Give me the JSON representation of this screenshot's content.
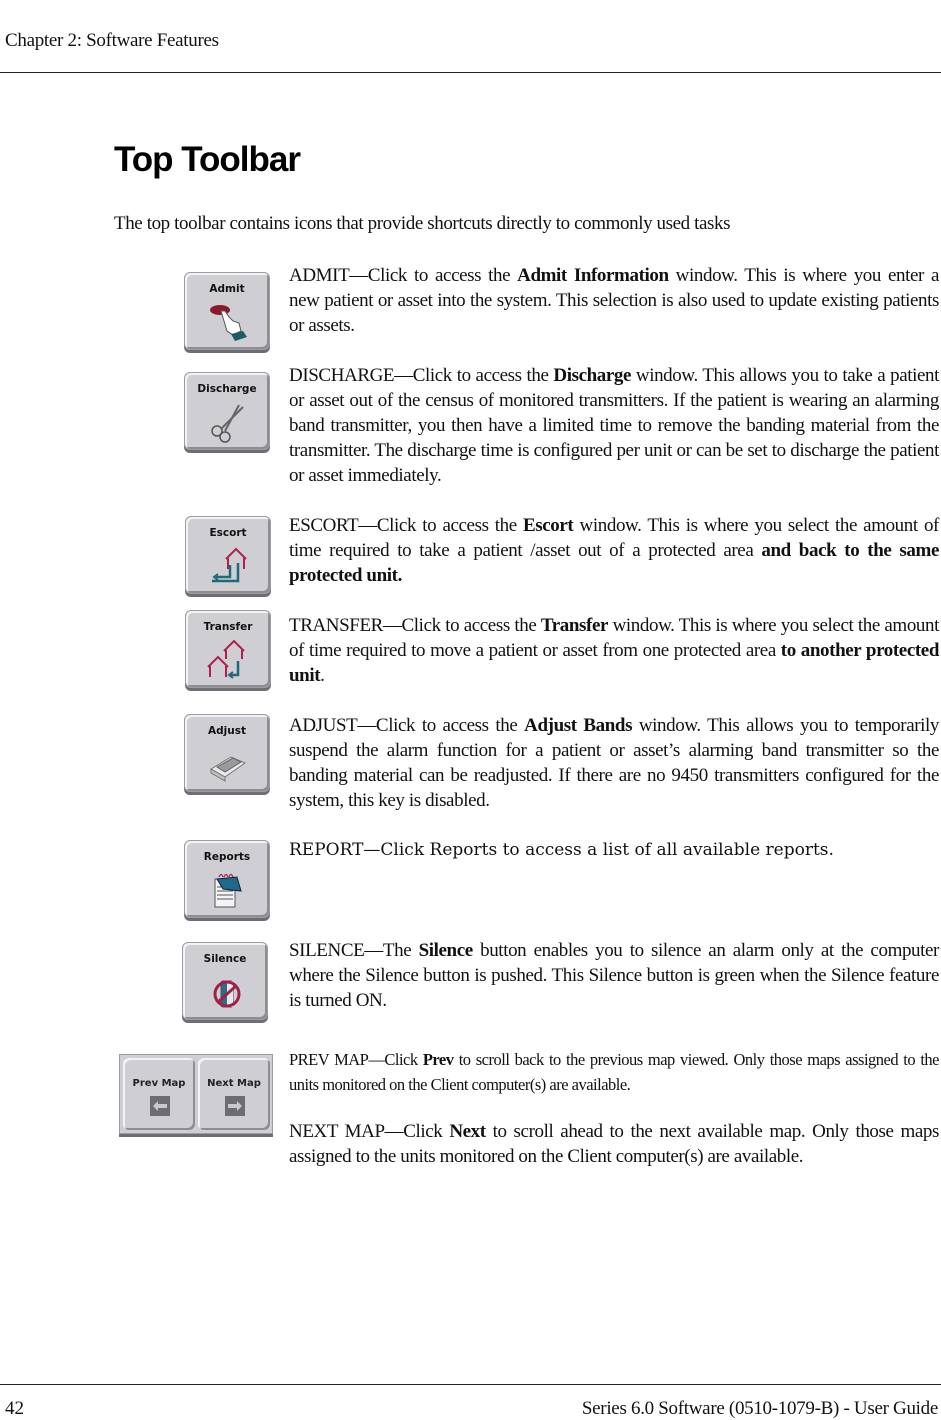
{
  "header": {
    "chapter": "Chapter 2: Software Features"
  },
  "title": "Top Toolbar",
  "intro": "The top toolbar contains icons that provide shortcuts directly to commonly used tasks",
  "buttons": [
    {
      "label": "Admit",
      "icon": "hand-pointer-icon"
    },
    {
      "label": "Discharge",
      "icon": "scissors-icon"
    },
    {
      "label": "Escort",
      "icon": "house-return-arrow-icon"
    },
    {
      "label": "Transfer",
      "icon": "house-to-house-arrow-icon"
    },
    {
      "label": "Adjust",
      "icon": "transmitter-band-icon"
    },
    {
      "label": "Reports",
      "icon": "notepad-icon"
    },
    {
      "label": "Silence",
      "icon": "speaker-muted-icon"
    },
    {
      "label": "Prev Map",
      "icon": "arrow-left-icon"
    },
    {
      "label": "Next Map",
      "icon": "arrow-right-icon"
    }
  ],
  "descriptions": {
    "admit": {
      "lead": "ADMIT—Click to access the ",
      "bold": "Admit Information",
      "rest": " window. This is where you enter a new patient or asset into the system. This selection is also used to update existing patients or assets."
    },
    "discharge": {
      "lead": "DISCHARGE—Click to access the ",
      "bold": "Discharge",
      "rest": " window. This allows you to take a patient or asset out of the census of monitored transmitters. If the patient is wearing an alarming band transmitter, you then have a limited time to remove the banding material from the transmitter. The discharge time is configured per unit or can be set to discharge the patient or asset immediately."
    },
    "escort": {
      "lead": "ESCORT—Click to access the ",
      "bold": "Escort",
      "mid": " window. This is where you select the amount of time required to take a patient /asset out of a protected area ",
      "bold2": "and back to the same protected unit."
    },
    "transfer": {
      "lead": "TRANSFER—Click to access the ",
      "bold": "Transfer",
      "mid": " window. This is where you select the amount of time required to move a patient or asset from one protected area ",
      "bold2": "to another protected unit",
      "tail": "."
    },
    "adjust": {
      "lead": "ADJUST—Click to access the ",
      "bold": "Adjust Bands",
      "rest": " window. This allows you to temporarily suspend the alarm function for a patient or asset’s alarming band transmitter so the banding material can be readjusted. If there are no 9450 transmitters configured for the system, this key is disabled."
    },
    "report": {
      "text": "REPORT—Click Reports to access a list of all available reports."
    },
    "silence": {
      "lead": "SILENCE—The ",
      "bold": "Silence",
      "rest": " button enables you to silence an alarm only at the computer where the Silence button is pushed. This Silence button is green when the Silence feature is turned ON."
    },
    "prev_map": {
      "lead": "PREV MAP—Click ",
      "bold": "Prev",
      "rest": " to scroll back to the previous map viewed. Only those maps assigned to the units monitored on the Client computer(s) are available."
    },
    "next_map": {
      "lead": "NEXT MAP—Click ",
      "bold": "Next",
      "rest": " to scroll ahead to the next available map. Only those maps assigned to the units monitored on the Client computer(s) are available."
    }
  },
  "footer": {
    "page_number": "42",
    "guide_title": "Series 6.0 Software (0510-1079-B) - User Guide"
  }
}
